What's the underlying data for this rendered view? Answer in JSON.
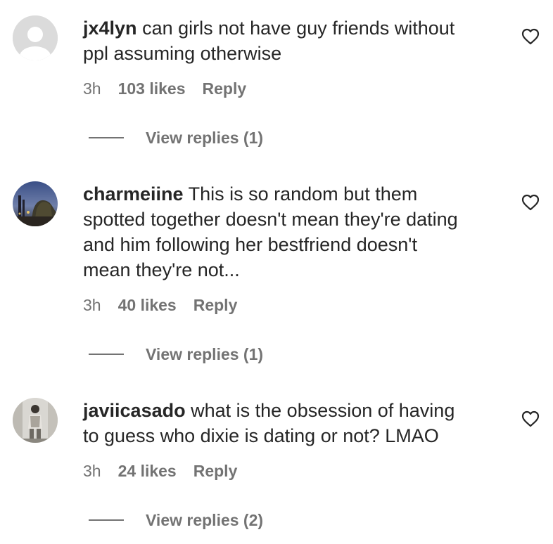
{
  "comments": [
    {
      "username": "jx4lyn",
      "text": "can girls not have guy friends without\nppl assuming otherwise",
      "time": "3h",
      "likes": "103 likes",
      "reply_label": "Reply",
      "view_replies": "View replies (1)",
      "avatar": "default-avatar"
    },
    {
      "username": "charmeiine",
      "text": "This is so random but them\nspotted together doesn't mean they're dating\nand him following her bestfriend doesn't\nmean they're not...",
      "time": "3h",
      "likes": "40 likes",
      "reply_label": "Reply",
      "view_replies": "View replies (1)",
      "avatar": "night-sky-photo"
    },
    {
      "username": "javiicasado",
      "text": "what is the obsession of having\nto guess who dixie is dating or not? LMAO",
      "time": "3h",
      "likes": "24 likes",
      "reply_label": "Reply",
      "view_replies": "View replies (2)",
      "avatar": "mirror-selfie-photo"
    }
  ],
  "icons": {
    "like": "heart-outline-icon"
  },
  "colors": {
    "text": "#262626",
    "secondary": "#737373",
    "avatar_placeholder": "#dbdbdb"
  }
}
